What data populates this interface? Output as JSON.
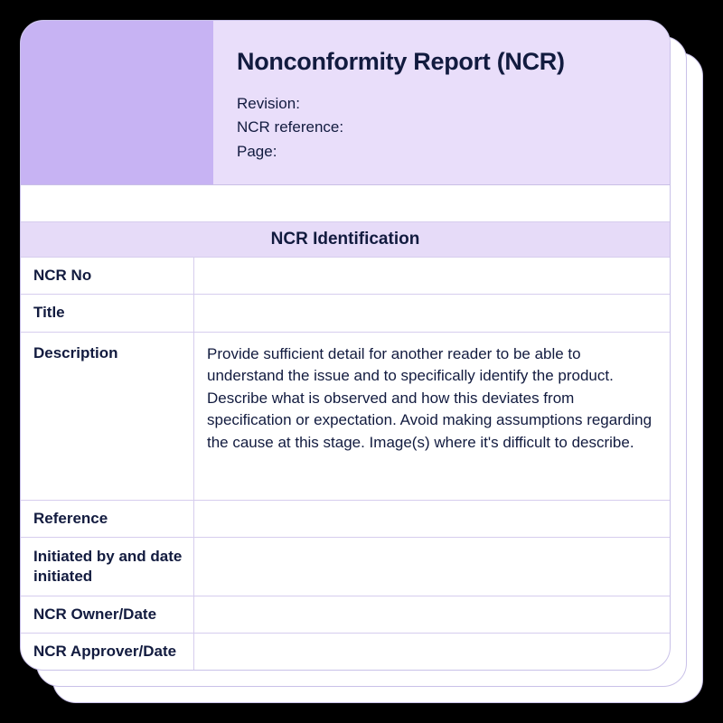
{
  "header": {
    "title": "Nonconformity Report (NCR)",
    "meta": {
      "revision_label": "Revision:",
      "ncr_ref_label": "NCR reference:",
      "page_label": "Page:"
    }
  },
  "section": {
    "title": "NCR Identification"
  },
  "rows": {
    "ncr_no": {
      "label": "NCR No",
      "value": ""
    },
    "title": {
      "label": "Title",
      "value": ""
    },
    "description": {
      "label": "Description",
      "value": "Provide sufficient detail for another reader to be able to understand the issue and to specifically identify the product. Describe what is observed and how this deviates from specification or expectation. Avoid making assumptions regarding the cause at this stage. Image(s) where it's difficult to describe."
    },
    "reference": {
      "label": "Reference",
      "value": ""
    },
    "initiated": {
      "label": "Initiated by and date initiated",
      "value": ""
    },
    "owner": {
      "label": "NCR Owner/Date",
      "value": ""
    },
    "approver": {
      "label": "NCR Approver/Date",
      "value": ""
    }
  }
}
